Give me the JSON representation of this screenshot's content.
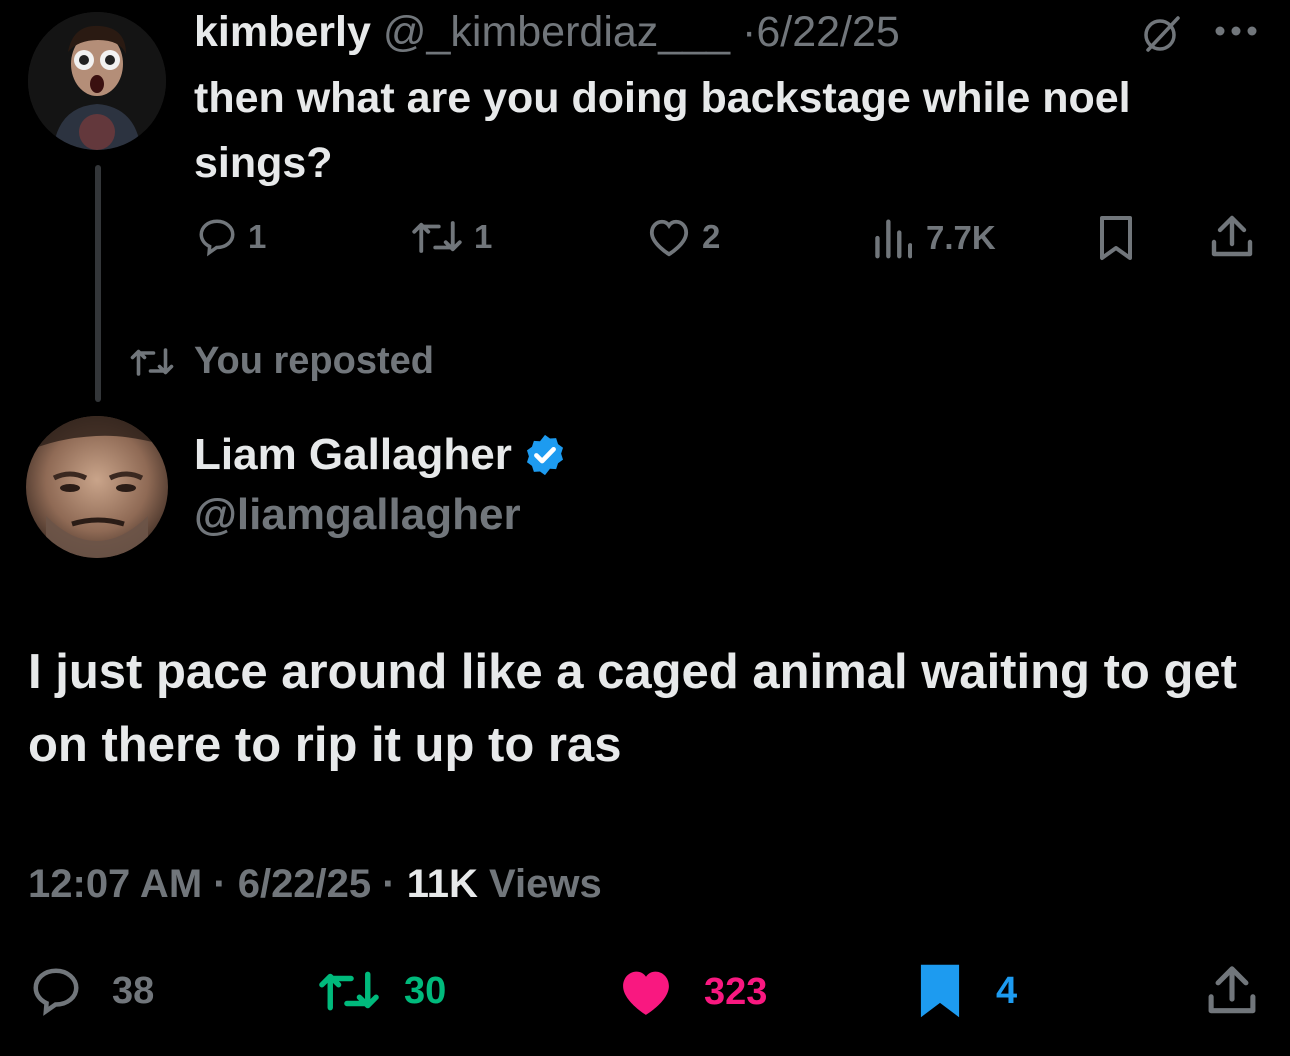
{
  "reply": {
    "display_name": "kimberly",
    "handle": "@_kimberdiaz___",
    "separator": "·",
    "date": "6/22/25",
    "text": "then what are you doing backstage while noel sings?",
    "replies": "1",
    "reposts": "1",
    "likes": "2",
    "views": "7.7K"
  },
  "repost_notice": "You reposted",
  "tweet": {
    "display_name": "Liam Gallagher",
    "handle": "@liamgallagher",
    "text": "I just pace around like a caged animal waiting to get on there to rip it up to ras",
    "time": "12:07 AM",
    "date": "6/22/25",
    "views_count": "11K",
    "views_label": "Views",
    "replies": "38",
    "reposts": "30",
    "likes": "323",
    "bookmarks": "4"
  },
  "colors": {
    "background": "#000000",
    "text_primary": "#e7e9ea",
    "text_secondary": "#71767b",
    "verified": "#1d9bf0",
    "repost_green": "#00ba7c",
    "like_pink": "#f91880",
    "bookmark_blue": "#1d9bf0"
  },
  "icons": [
    "grok-icon",
    "more-icon",
    "reply-icon",
    "repost-icon",
    "like-icon",
    "views-icon",
    "bookmark-icon",
    "share-icon",
    "verified-badge-icon"
  ]
}
